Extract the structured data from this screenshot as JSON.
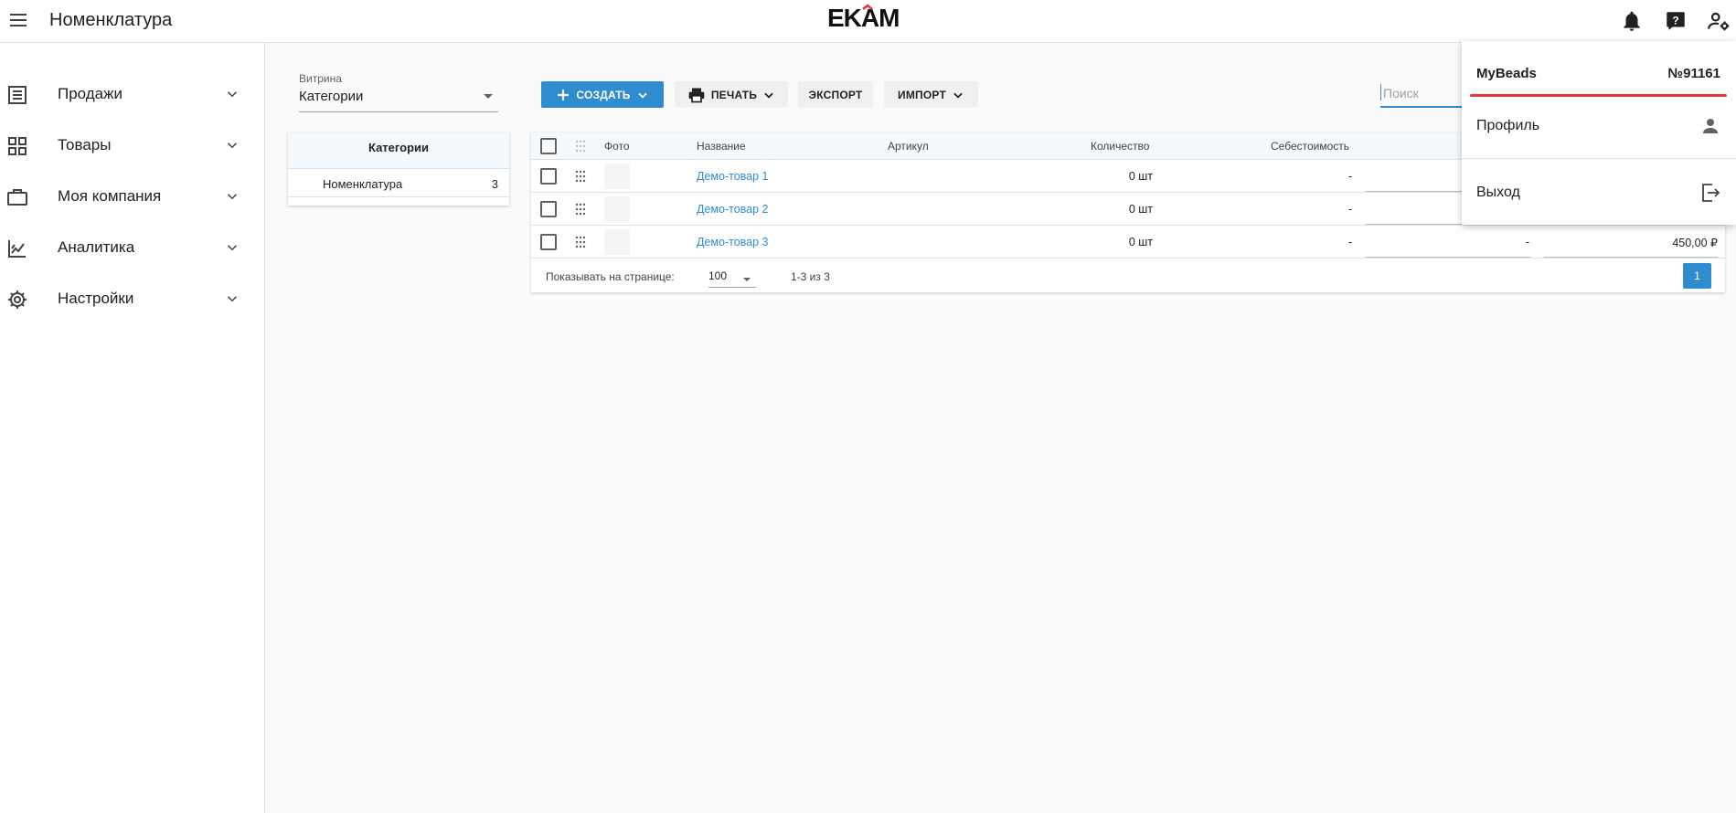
{
  "header": {
    "title": "Номенклатура",
    "logo_text": "EKAM"
  },
  "sidebar": {
    "items": [
      {
        "label": "Продажи",
        "icon": "list-icon"
      },
      {
        "label": "Товары",
        "icon": "grid-icon"
      },
      {
        "label": "Моя компания",
        "icon": "briefcase-icon"
      },
      {
        "label": "Аналитика",
        "icon": "analytics-icon"
      },
      {
        "label": "Настройки",
        "icon": "gear-icon"
      }
    ]
  },
  "vitrina": {
    "caption": "Витрина",
    "value": "Категории"
  },
  "categories": {
    "header": "Категории",
    "rows": [
      {
        "name": "Номенклатура",
        "count": "3"
      }
    ]
  },
  "toolbar": {
    "create_label": "СОЗДАТЬ",
    "print_label": "ПЕЧАТЬ",
    "export_label": "ЭКСПОРТ",
    "import_label": "ИМПОРТ",
    "search_placeholder": "Поиск"
  },
  "table": {
    "columns": {
      "photo": "Фото",
      "name": "Название",
      "article": "Артикул",
      "quantity": "Количество",
      "cost": "Себестоимость"
    },
    "rows": [
      {
        "name": "Демо-товар 1",
        "article": "",
        "quantity": "0 шт",
        "cost": "-",
        "extra": "",
        "price": ""
      },
      {
        "name": "Демо-товар 2",
        "article": "",
        "quantity": "0 шт",
        "cost": "-",
        "extra": "",
        "price": ""
      },
      {
        "name": "Демо-товар 3",
        "article": "",
        "quantity": "0 шт",
        "cost": "-",
        "extra": "-",
        "price": "450,00 ₽"
      }
    ],
    "footer": {
      "per_page_label": "Показывать на странице:",
      "per_page_value": "100",
      "range": "1-3 из 3",
      "page": "1"
    }
  },
  "account_menu": {
    "account_name": "MyBeads",
    "account_number": "№91161",
    "profile_label": "Профиль",
    "logout_label": "Выход"
  },
  "colors": {
    "accent": "#2e8ccf",
    "underline_red": "#e53935",
    "header_bg": "#f3f9fd"
  }
}
